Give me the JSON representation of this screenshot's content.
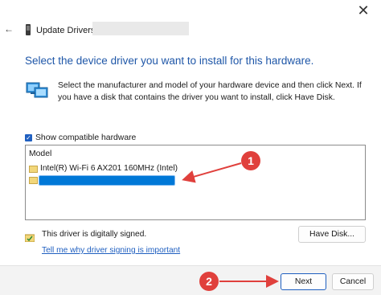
{
  "window": {
    "title": "Update Drivers -",
    "close_glyph": "✕",
    "back_glyph": "←"
  },
  "heading": "Select the device driver you want to install for this hardware.",
  "intro": "Select the manufacturer and model of your hardware device and then click Next. If you have a disk that contains the driver you want to install, click Have Disk.",
  "compatible": {
    "label": "Show compatible hardware",
    "checked": true,
    "check_glyph": "✓"
  },
  "model_list": {
    "header": "Model",
    "items": [
      {
        "label": "Intel(R) Wi-Fi 6 AX201 160MHz (Intel)",
        "selected": false
      },
      {
        "label": "",
        "selected": true
      }
    ]
  },
  "signature": {
    "status": "This driver is digitally signed.",
    "link": "Tell me why driver signing is important"
  },
  "buttons": {
    "have_disk": "Have Disk...",
    "next": "Next",
    "cancel": "Cancel"
  },
  "annotations": {
    "marker_1": "1",
    "marker_2": "2",
    "color": "#e0403c"
  },
  "colors": {
    "heading": "#1f57a8",
    "selection": "#0078d7",
    "link": "#1f5fc0"
  }
}
